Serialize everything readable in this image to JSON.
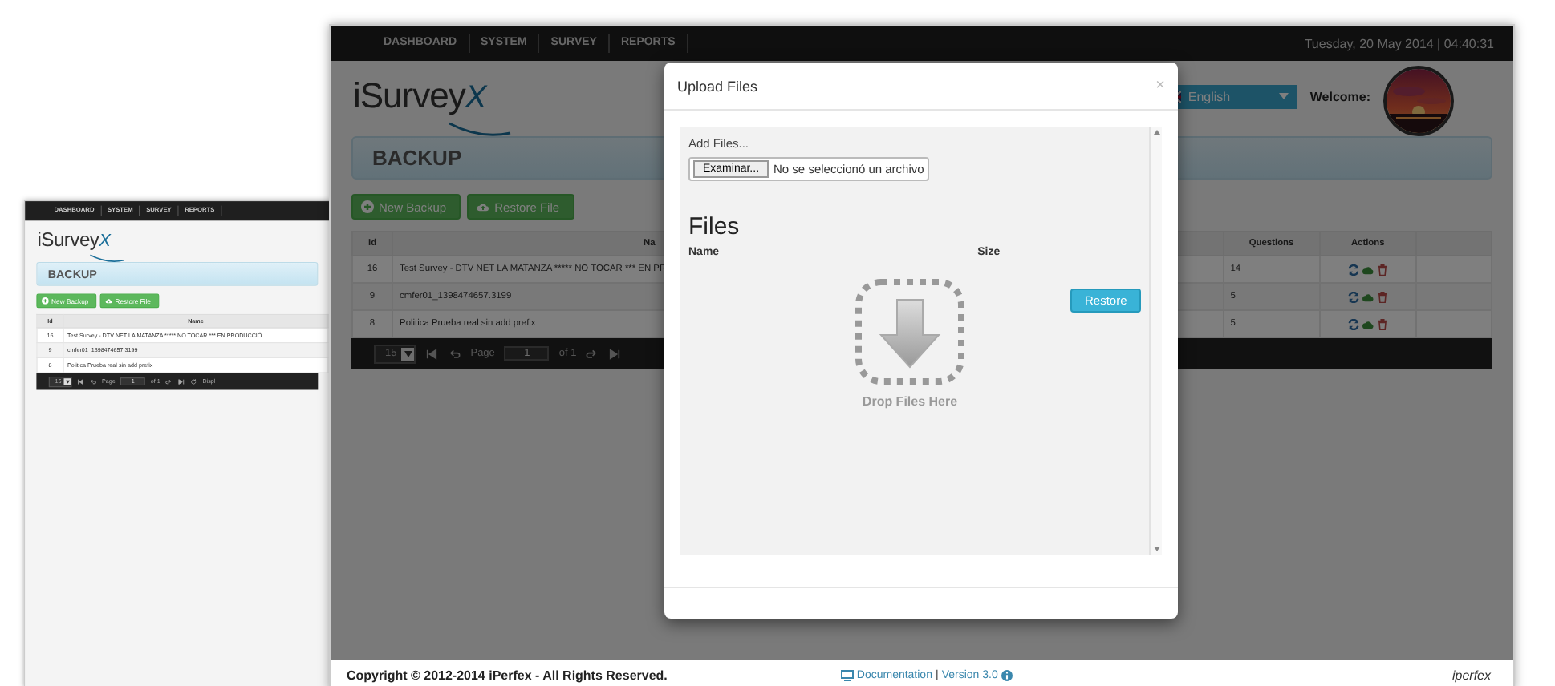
{
  "back_screen": {
    "nav": [
      "DASHBOARD",
      "SYSTEM",
      "SURVEY",
      "REPORTS"
    ],
    "logo_main": "iSurvey",
    "logo_mark": "X",
    "page_title": "BACKUP",
    "buttons": [
      {
        "label": "New Backup",
        "kind": "add"
      },
      {
        "label": "Restore File",
        "kind": "upload"
      }
    ],
    "columns": [
      "Id",
      "Name"
    ],
    "rows": [
      {
        "id": "16",
        "name": "Test Survey - DTV NET LA MATANZA ***** NO TOCAR *** EN PRODUCCIÓ"
      },
      {
        "id": "9",
        "name": "cmfer01_1398474657.3199"
      },
      {
        "id": "8",
        "name": "Politica Prueba real sin add prefix"
      }
    ],
    "pager": {
      "page_size": "15",
      "page_label": "Page",
      "page": "1",
      "of": "of 1",
      "display": "Displ"
    }
  },
  "front_screen": {
    "nav": [
      "DASHBOARD",
      "SYSTEM",
      "SURVEY",
      "REPORTS"
    ],
    "datetime": "Tuesday, 20 May 2014 | 04:40:31",
    "logo_main": "iSurvey",
    "logo_mark": "X",
    "language": "English",
    "welcome": "Welcome:",
    "page_title": "BACKUP",
    "buttons": [
      {
        "label": "New Backup",
        "kind": "add"
      },
      {
        "label": "Restore File",
        "kind": "upload"
      }
    ],
    "columns": [
      "Id",
      "Na",
      "Questions",
      "Actions"
    ],
    "rows": [
      {
        "id": "16",
        "name": "Test Survey - DTV NET LA MATANZA ***** NO TOCAR *** EN PR",
        "questions": "14"
      },
      {
        "id": "9",
        "name": "cmfer01_1398474657.3199",
        "questions": "5"
      },
      {
        "id": "8",
        "name": "Politica Prueba real sin add prefix",
        "questions": "5"
      }
    ],
    "pager": {
      "page_size": "15",
      "page_label": "Page",
      "page": "1",
      "of": "of 1"
    }
  },
  "upload_dialog": {
    "title": "Upload Files",
    "close": "×",
    "add_files_label": "Add Files...",
    "browse_button": "Examinar...",
    "file_status": "No se seleccionó un archivo",
    "files_heading": "Files",
    "name_header": "Name",
    "size_header": "Size",
    "drop_label": "Drop Files Here",
    "restore_button": "Restore"
  },
  "footer": {
    "copyright": "Copyright © 2012-2014 iPerfex - All Rights Reserved.",
    "documentation": "Documentation",
    "separator": "|",
    "version": "Version 3.0",
    "brand": "iperfex"
  }
}
